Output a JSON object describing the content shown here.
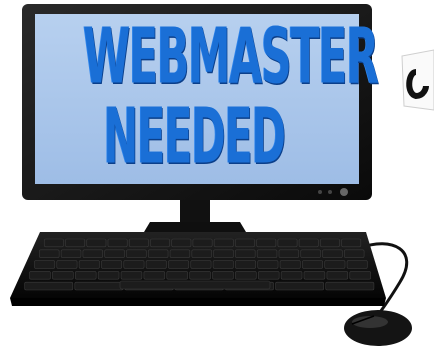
{
  "headline": {
    "line1": "WEBMASTER",
    "line2": "NEEDED"
  },
  "colors": {
    "screen_bg": "#a9c6ea",
    "screen_text": "#1a6fd6",
    "monitor_body": "#141414",
    "keyboard": "#0f0f0f"
  },
  "icons": {
    "monitor": "monitor-icon",
    "keyboard": "keyboard-icon",
    "mouse": "mouse-icon"
  }
}
